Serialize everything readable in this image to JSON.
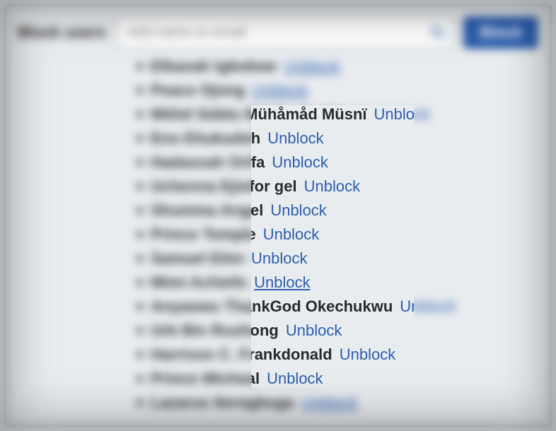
{
  "header": {
    "label": "Block users",
    "search_placeholder": "Add name or email",
    "block_label": "Block"
  },
  "unblock_label": "Unblock",
  "list": [
    {
      "name": "Elkanah Igbokwe",
      "underlined": true
    },
    {
      "name": "Peace Ojong",
      "underlined": true
    },
    {
      "name": "Möhd Sübtu Mühåmåd Müsnï",
      "underlined": false
    },
    {
      "name": "Eno Ehukudoh",
      "underlined": false
    },
    {
      "name": "Hadassah Orifa",
      "underlined": false
    },
    {
      "name": "Uchenna Ejiofor gel",
      "underlined": false
    },
    {
      "name": "Shumma Angel",
      "underlined": false
    },
    {
      "name": "Prince Temple",
      "underlined": false
    },
    {
      "name": "Samuel Etim",
      "underlined": false
    },
    {
      "name": "Mimi Achiefo",
      "underlined": true
    },
    {
      "name": "Anyaowu ThankGod Okechukwu",
      "underlined": false
    },
    {
      "name": "Urb Bin Rushong",
      "underlined": false
    },
    {
      "name": "Harrison C. Frankdonald",
      "underlined": false
    },
    {
      "name": "Prince Micheal",
      "underlined": false
    },
    {
      "name": "Lazarus Iterogbuga",
      "underlined": true
    }
  ]
}
